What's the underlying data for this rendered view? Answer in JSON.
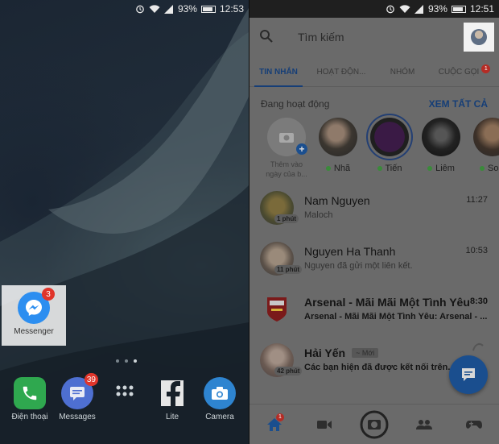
{
  "home": {
    "status": {
      "percent": "93%",
      "time": "12:53"
    },
    "apps": {
      "messenger": {
        "label": "Messenger",
        "badge": "3"
      },
      "phone": {
        "label": "Điện thoại"
      },
      "messages": {
        "label": "Messages",
        "badge": "39"
      },
      "facebook_lite": {
        "label": "Lite"
      },
      "camera": {
        "label": "Camera"
      }
    }
  },
  "messenger": {
    "status": {
      "percent": "93%",
      "time": "12:51"
    },
    "search": {
      "placeholder": "Tìm kiếm"
    },
    "tabs": [
      {
        "label": "TIN NHẮN"
      },
      {
        "label": "HOẠT ĐỘN..."
      },
      {
        "label": "NHÓM"
      },
      {
        "label": "CUỘC GỌI",
        "badge": "1"
      }
    ],
    "active_now": {
      "title": "Đang hoạt động",
      "see_all": "XEM TẤT CẢ"
    },
    "add_story": {
      "label_line1": "Thêm vào",
      "label_line2": "ngày của b..."
    },
    "stories": [
      {
        "name": "Nhã"
      },
      {
        "name": "Tiến"
      },
      {
        "name": "Liêm"
      },
      {
        "name": "Sole"
      }
    ],
    "conversations": [
      {
        "name": "Nam Nguyen",
        "preview": "Maloch",
        "time": "11:27",
        "ago": "1 phút"
      },
      {
        "name": "Nguyen Ha Thanh",
        "preview": "Nguyen đã gửi một liên kết.",
        "time": "10:53",
        "ago": "11 phút"
      },
      {
        "name": "Arsenal - Mãi Mãi Một Tình Yêu",
        "preview": "Arsenal - Mãi Mãi Một Tình Yêu: Arsenal - ...",
        "time": "8:30"
      },
      {
        "name": "Hải Yến",
        "new_tag": "~ Mới",
        "preview": "Các bạn hiện đã được kết nối trên...",
        "ago": "42 phút"
      }
    ],
    "nav_badge": "1"
  }
}
